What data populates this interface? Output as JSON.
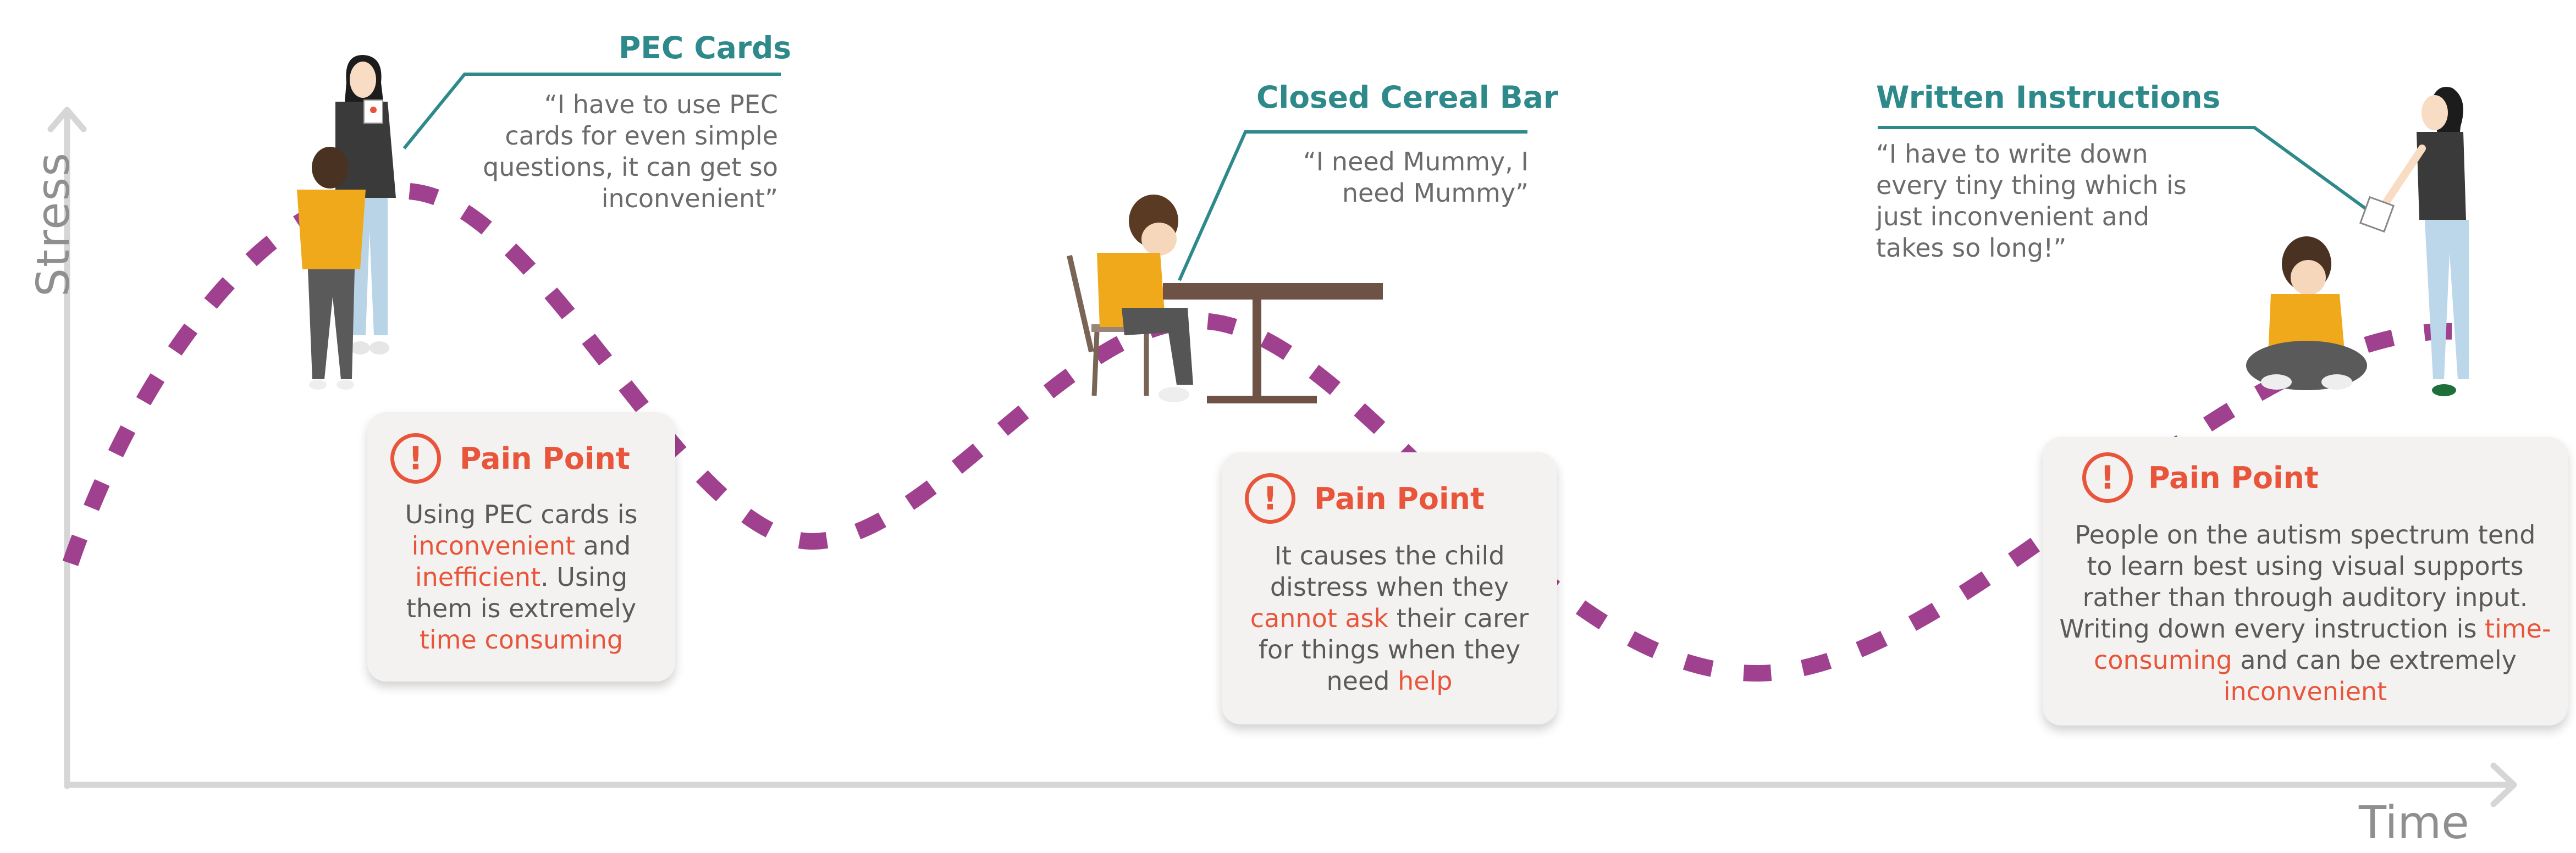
{
  "axes": {
    "y_label": "Stress",
    "x_label": "Time"
  },
  "colors": {
    "axis": "#d6d6d6",
    "curve": "#a0418f",
    "teal": "#2e8a8a",
    "pain": "#e8553a",
    "card_bg": "#f3f2f1"
  },
  "stages": [
    {
      "title": "PEC Cards",
      "quote": "“I have to use PEC cards for even simple questions, it can get so inconvenient”",
      "illustration": "parent-holding-pec-card-with-child",
      "pain": {
        "icon": "exclamation-circle-icon",
        "title": "Pain Point",
        "body": [
          {
            "t": "Using PEC cards is ",
            "h": false
          },
          {
            "t": "inconvenient",
            "h": true
          },
          {
            "t": " and ",
            "h": false
          },
          {
            "t": "inefficient",
            "h": true
          },
          {
            "t": ". Using them is extremely ",
            "h": false
          },
          {
            "t": "time consuming",
            "h": true
          }
        ]
      }
    },
    {
      "title": "Closed Cereal Bar",
      "quote": "“I need Mummy, I need Mummy”",
      "illustration": "child-sitting-at-table",
      "pain": {
        "icon": "exclamation-circle-icon",
        "title": "Pain Point",
        "body": [
          {
            "t": "It causes the child distress when they ",
            "h": false
          },
          {
            "t": "cannot ask",
            "h": true
          },
          {
            "t": " their carer for things when they need ",
            "h": false
          },
          {
            "t": "help",
            "h": true
          }
        ]
      }
    },
    {
      "title": "Written Instructions",
      "quote": "“I have to write down every tiny thing which is just inconvenient and takes so long!”",
      "illustration": "parent-showing-note-to-seated-child",
      "pain": {
        "icon": "exclamation-circle-icon",
        "title": "Pain Point",
        "body": [
          {
            "t": "People on the autism spectrum tend to learn best using visual supports rather than through auditory input. Writing down every instruction is ",
            "h": false
          },
          {
            "t": "time-consuming",
            "h": true
          },
          {
            "t": " and can be extremely ",
            "h": false
          },
          {
            "t": "inconvenient",
            "h": true
          }
        ]
      }
    }
  ]
}
